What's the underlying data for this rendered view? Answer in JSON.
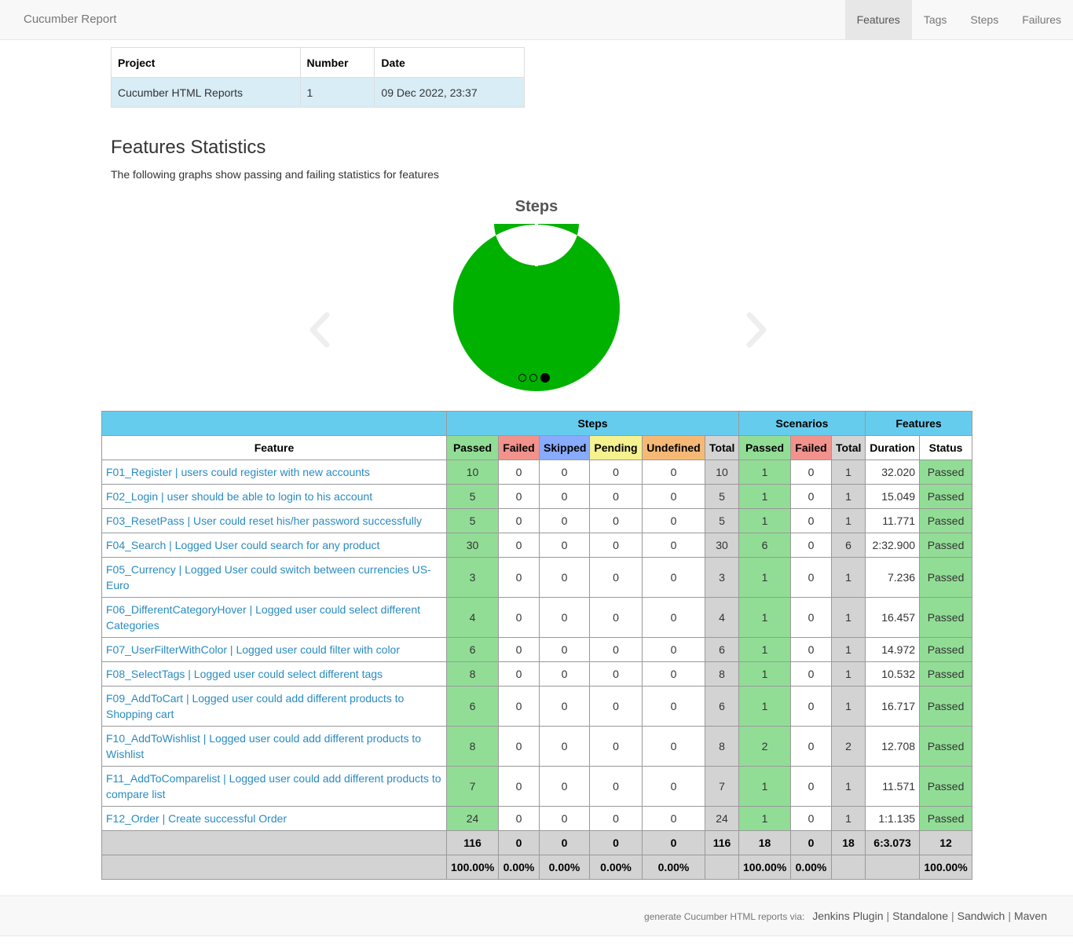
{
  "navbar": {
    "brand": "Cucumber Report",
    "tabs": [
      {
        "label": "Features",
        "active": true
      },
      {
        "label": "Tags",
        "active": false
      },
      {
        "label": "Steps",
        "active": false
      },
      {
        "label": "Failures",
        "active": false
      }
    ]
  },
  "info": {
    "headers": [
      "Project",
      "Number",
      "Date"
    ],
    "values": [
      "Cucumber HTML Reports",
      "1",
      "09 Dec 2022, 23:37"
    ]
  },
  "section": {
    "title": "Features Statistics",
    "description": "The following graphs show passing and failing statistics for features"
  },
  "carousel": {
    "slide_count": 3,
    "active_slide": 3
  },
  "chart_data": {
    "type": "pie",
    "title": "Steps",
    "donut": true,
    "categories": [
      "Passed",
      "Failed",
      "Skipped",
      "Pending",
      "Undefined"
    ],
    "values": [
      116,
      0,
      0,
      0,
      0
    ],
    "colors": [
      "#00b100",
      "#f2928c",
      "#88aaff",
      "#f5f28f",
      "#f5b975"
    ]
  },
  "stats": {
    "group_headers": {
      "steps": "Steps",
      "scenarios": "Scenarios",
      "features": "Features"
    },
    "columns": {
      "feature": "Feature",
      "steps_passed": "Passed",
      "steps_failed": "Failed",
      "steps_skipped": "Skipped",
      "steps_pending": "Pending",
      "steps_undefined": "Undefined",
      "steps_total": "Total",
      "sc_passed": "Passed",
      "sc_failed": "Failed",
      "sc_total": "Total",
      "duration": "Duration",
      "status": "Status"
    },
    "rows": [
      {
        "name": "F01_Register | users could register with new accounts",
        "tall": false,
        "sp": "10",
        "sf": "0",
        "ss": "0",
        "spe": "0",
        "su": "0",
        "st": "10",
        "cp": "1",
        "cf": "0",
        "ct": "1",
        "dur": "32.020",
        "status": "Passed"
      },
      {
        "name": "F02_Login | user should be able to login to his account",
        "tall": false,
        "sp": "5",
        "sf": "0",
        "ss": "0",
        "spe": "0",
        "su": "0",
        "st": "5",
        "cp": "1",
        "cf": "0",
        "ct": "1",
        "dur": "15.049",
        "status": "Passed"
      },
      {
        "name": "F03_ResetPass | User could reset his/her password successfully",
        "tall": false,
        "sp": "5",
        "sf": "0",
        "ss": "0",
        "spe": "0",
        "su": "0",
        "st": "5",
        "cp": "1",
        "cf": "0",
        "ct": "1",
        "dur": "11.771",
        "status": "Passed"
      },
      {
        "name": "F04_Search | Logged User could search for any product",
        "tall": false,
        "sp": "30",
        "sf": "0",
        "ss": "0",
        "spe": "0",
        "su": "0",
        "st": "30",
        "cp": "6",
        "cf": "0",
        "ct": "6",
        "dur": "2:32.900",
        "status": "Passed"
      },
      {
        "name": "F05_Currency | Logged User could switch between currencies US-Euro",
        "tall": true,
        "sp": "3",
        "sf": "0",
        "ss": "0",
        "spe": "0",
        "su": "0",
        "st": "3",
        "cp": "1",
        "cf": "0",
        "ct": "1",
        "dur": "7.236",
        "status": "Passed"
      },
      {
        "name": "F06_DifferentCategoryHover | Logged user could select different Categories",
        "tall": true,
        "sp": "4",
        "sf": "0",
        "ss": "0",
        "spe": "0",
        "su": "0",
        "st": "4",
        "cp": "1",
        "cf": "0",
        "ct": "1",
        "dur": "16.457",
        "status": "Passed"
      },
      {
        "name": "F07_UserFilterWithColor | Logged user could filter with color",
        "tall": false,
        "sp": "6",
        "sf": "0",
        "ss": "0",
        "spe": "0",
        "su": "0",
        "st": "6",
        "cp": "1",
        "cf": "0",
        "ct": "1",
        "dur": "14.972",
        "status": "Passed"
      },
      {
        "name": "F08_SelectTags | Logged user could select different tags",
        "tall": false,
        "sp": "8",
        "sf": "0",
        "ss": "0",
        "spe": "0",
        "su": "0",
        "st": "8",
        "cp": "1",
        "cf": "0",
        "ct": "1",
        "dur": "10.532",
        "status": "Passed"
      },
      {
        "name": "F09_AddToCart | Logged user could add different products to Shopping cart",
        "tall": true,
        "sp": "6",
        "sf": "0",
        "ss": "0",
        "spe": "0",
        "su": "0",
        "st": "6",
        "cp": "1",
        "cf": "0",
        "ct": "1",
        "dur": "16.717",
        "status": "Passed"
      },
      {
        "name": "F10_AddToWishlist | Logged user could add different products to Wishlist",
        "tall": true,
        "sp": "8",
        "sf": "0",
        "ss": "0",
        "spe": "0",
        "su": "0",
        "st": "8",
        "cp": "2",
        "cf": "0",
        "ct": "2",
        "dur": "12.708",
        "status": "Passed"
      },
      {
        "name": "F11_AddToComparelist | Logged user could add different products to compare list",
        "tall": true,
        "sp": "7",
        "sf": "0",
        "ss": "0",
        "spe": "0",
        "su": "0",
        "st": "7",
        "cp": "1",
        "cf": "0",
        "ct": "1",
        "dur": "11.571",
        "status": "Passed"
      },
      {
        "name": "F12_Order | Create successful Order",
        "tall": false,
        "sp": "24",
        "sf": "0",
        "ss": "0",
        "spe": "0",
        "su": "0",
        "st": "24",
        "cp": "1",
        "cf": "0",
        "ct": "1",
        "dur": "1:1.135",
        "status": "Passed"
      }
    ],
    "totals": {
      "feature": "",
      "sp": "116",
      "sf": "0",
      "ss": "0",
      "spe": "0",
      "su": "0",
      "st": "116",
      "cp": "18",
      "cf": "0",
      "ct": "18",
      "dur": "6:3.073",
      "status": "12"
    },
    "percents": {
      "feature": "",
      "sp": "100.00%",
      "sf": "0.00%",
      "ss": "0.00%",
      "spe": "0.00%",
      "su": "0.00%",
      "st": "",
      "cp": "100.00%",
      "cf": "0.00%",
      "ct": "",
      "dur": "",
      "status": "100.00%"
    }
  },
  "footer": {
    "via_text": "generate Cucumber HTML reports via:",
    "links": [
      "Jenkins Plugin",
      "Standalone",
      "Sandwich",
      "Maven"
    ],
    "separator": "|"
  }
}
